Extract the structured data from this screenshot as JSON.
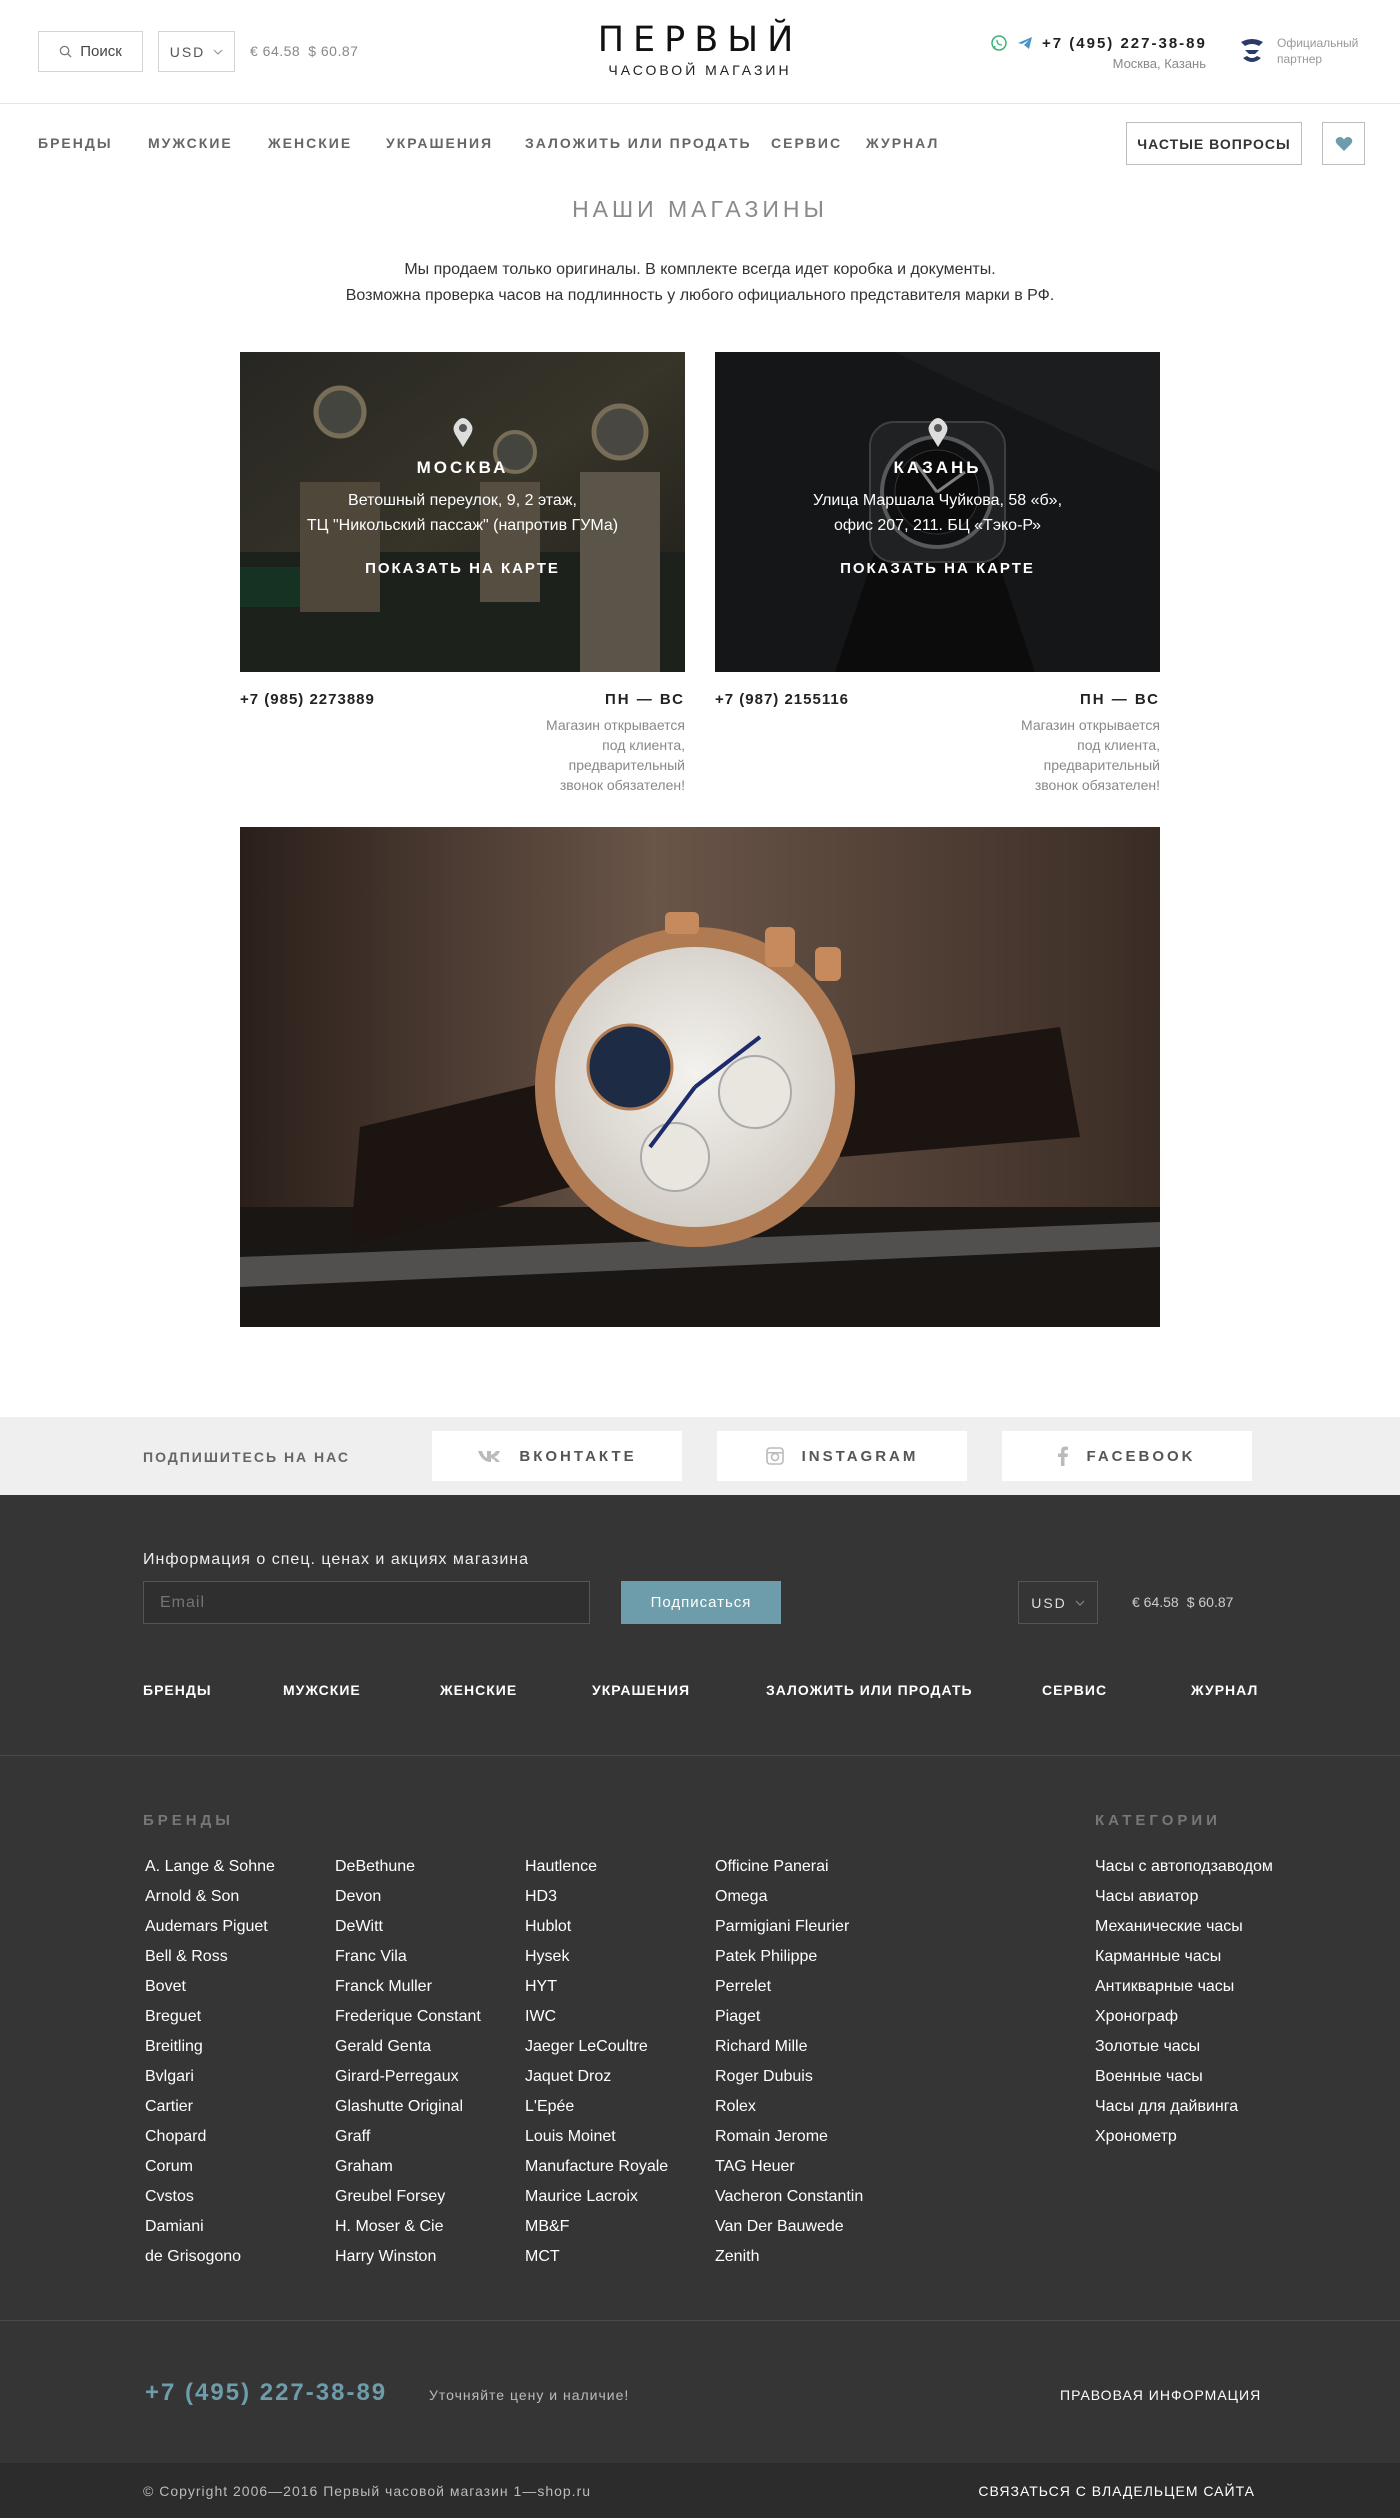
{
  "header": {
    "search_label": "Поиск",
    "currency": "USD",
    "rate_eur": "€ 64.58",
    "rate_usd": "$ 60.87",
    "logo_title": "ПЕРВЫЙ",
    "logo_subtitle": "ЧАСОВОЙ МАГАЗИН",
    "phone": "+7 (495) 227-38-89",
    "cities": "Москва, Казань",
    "partner_line1": "Официальный",
    "partner_line2": "партнер"
  },
  "nav": {
    "items": [
      "БРЕНДЫ",
      "МУЖСКИЕ",
      "ЖЕНСКИЕ",
      "УКРАШЕНИЯ",
      "ЗАЛОЖИТЬ ИЛИ ПРОДАТЬ",
      "СЕРВИС",
      "ЖУРНАЛ"
    ],
    "faq": "ЧАСТЫЕ ВОПРОСЫ"
  },
  "main": {
    "title": "НАШИ МАГАЗИНЫ",
    "intro_line1": "Мы продаем только оригиналы. В комплекте всегда идет коробка и документы.",
    "intro_line2": "Возможна проверка часов на подлинность у любого официального представителя марки в РФ.",
    "stores": [
      {
        "city": "МОСКВА",
        "addr1": "Ветошный переулок, 9, 2 этаж,",
        "addr2": "ТЦ \"Никольский пассаж\" (напротив ГУМа)",
        "map_link": "ПОКАЗАТЬ НА КАРТЕ",
        "phone": "+7 (985) 2273889",
        "days": "ПН — ВС",
        "note1": "Магазин открывается",
        "note2": "под клиента, предварительный",
        "note3": "звонок обязателен!"
      },
      {
        "city": "КАЗАНЬ",
        "addr1": "Улица Маршала Чуйкова, 58 «б»,",
        "addr2": "офис 207, 211. БЦ «Тэко-Р»",
        "map_link": "ПОКАЗАТЬ НА КАРТЕ",
        "phone": "+7 (987) 2155116",
        "days": "ПН — ВС",
        "note1": "Магазин открывается",
        "note2": "под клиента, предварительный",
        "note3": "звонок обязателен!"
      }
    ]
  },
  "social": {
    "label": "ПОДПИШИТЕСЬ НА НАС",
    "vk": "ВКОНТАКТЕ",
    "instagram": "INSTAGRAM",
    "facebook": "FACEBOOK"
  },
  "footer": {
    "subscribe_label": "Информация о спец. ценах и акциях магазина",
    "email_placeholder": "Email",
    "subscribe_button": "Подписаться",
    "currency": "USD",
    "rate_eur": "€ 64.58",
    "rate_usd": "$ 60.87",
    "nav": [
      "БРЕНДЫ",
      "МУЖСКИЕ",
      "ЖЕНСКИЕ",
      "УКРАШЕНИЯ",
      "ЗАЛОЖИТЬ ИЛИ ПРОДАТЬ",
      "СЕРВИС",
      "ЖУРНАЛ"
    ],
    "brands_heading": "БРЕНДЫ",
    "categories_heading": "КАТЕГОРИИ",
    "brand_columns": [
      [
        "A. Lange & Sohne",
        "Arnold & Son",
        "Audemars Piguet",
        "Bell & Ross",
        "Bovet",
        "Breguet",
        "Breitling",
        "Bvlgari",
        "Cartier",
        "Chopard",
        "Corum",
        "Cvstos",
        "Damiani",
        "de Grisogono"
      ],
      [
        "DeBethune",
        "Devon",
        "DeWitt",
        "Franc Vila",
        "Franck Muller",
        "Frederique Constant",
        "Gerald Genta",
        "Girard-Perregaux",
        "Glashutte Original",
        "Graff",
        "Graham",
        "Greubel Forsey",
        "H. Moser & Cie",
        "Harry Winston"
      ],
      [
        "Hautlence",
        "HD3",
        "Hublot",
        "Hysek",
        "HYT",
        "IWC",
        "Jaeger LeCoultre",
        "Jaquet Droz",
        "L'Epée",
        "Louis Moinet",
        "Manufacture Royale",
        "Maurice Lacroix",
        "MB&F",
        "MCT"
      ],
      [
        "Officine Panerai",
        "Omega",
        "Parmigiani Fleurier",
        "Patek Philippe",
        "Perrelet",
        "Piaget",
        "Richard Mille",
        "Roger Dubuis",
        "Rolex",
        "Romain Jerome",
        "TAG Heuer",
        "Vacheron Constantin",
        "Van Der Bauwede",
        "Zenith"
      ]
    ],
    "categories": [
      "Часы с автоподзаводом",
      "Часы авиатор",
      "Механические часы",
      "Карманные часы",
      "Антикварные часы",
      "Хронограф",
      "Золотые часы",
      "Военные часы",
      "Часы для дайвинга",
      "Хронометр"
    ],
    "phone": "+7 (495) 227-38-89",
    "phone_hint": "Уточняйте цену и наличие!",
    "legal": "ПРАВОВАЯ ИНФОРМАЦИЯ",
    "copyright": "© Copyright 2006—2016 Первый часовой магазин 1—shop.ru",
    "contact_owner": "СВЯЗАТЬСЯ С ВЛАДЕЛЬЦЕМ САЙТА"
  },
  "colors": {
    "accent": "#6d9cab",
    "footer_bg": "#353535",
    "social_bg": "#efefef"
  }
}
